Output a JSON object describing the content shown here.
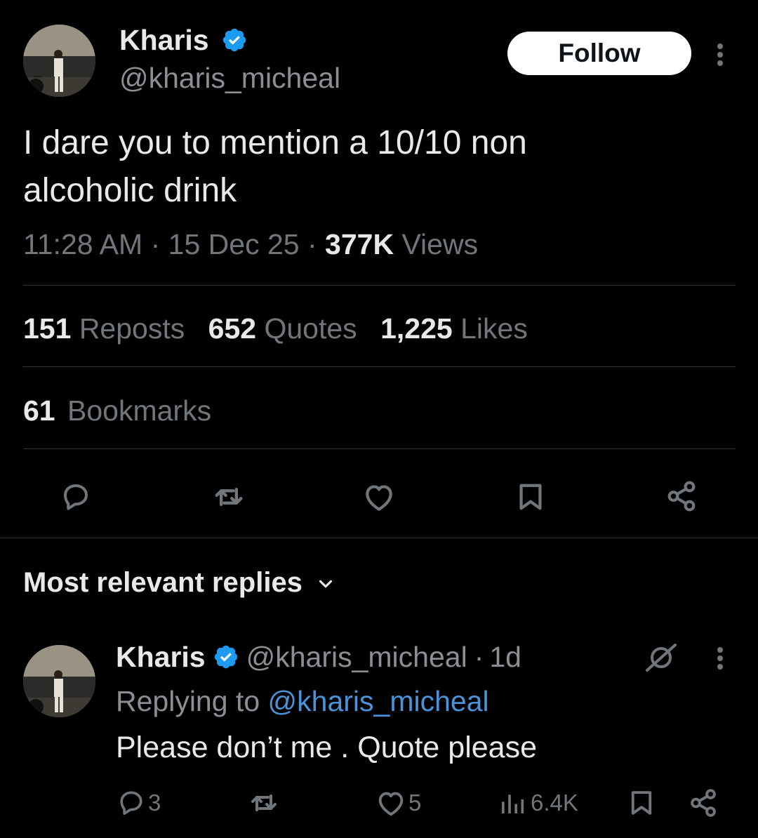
{
  "tweet": {
    "author_name": "Kharis",
    "author_handle": "@kharis_micheal",
    "follow_label": "Follow",
    "text_line1": "I dare you to mention a 10/10 non",
    "text_line2": "alcoholic drink",
    "time": "11:28 AM",
    "sep1": "·",
    "date": "15 Dec 25",
    "sep2": "·",
    "views_count": "377K",
    "views_label": "Views",
    "reposts_count": "151",
    "reposts_label": "Reposts",
    "quotes_count": "652",
    "quotes_label": "Quotes",
    "likes_count": "1,225",
    "likes_label": "Likes",
    "bookmarks_count": "61",
    "bookmarks_label": "Bookmarks"
  },
  "action_icons": [
    "reply-icon",
    "repost-icon",
    "like-icon",
    "bookmark-icon",
    "share-icon"
  ],
  "replies_header": {
    "label": "Most relevant replies"
  },
  "reply": {
    "author_name": "Kharis",
    "author_handle": "@kharis_micheal",
    "sep": "·",
    "age": "1d",
    "replying_prefix": "Replying to",
    "replying_handle": "@kharis_micheal",
    "text": "Please don’t me . Quote please",
    "reply_count": "3",
    "like_count": "5",
    "views_count": "6.4K"
  },
  "colors": {
    "background": "#000000",
    "text": "#e7e9ea",
    "muted": "#71767b",
    "verified": "#1d9bf0",
    "link": "#4a93d8",
    "divider": "#2f3336"
  }
}
